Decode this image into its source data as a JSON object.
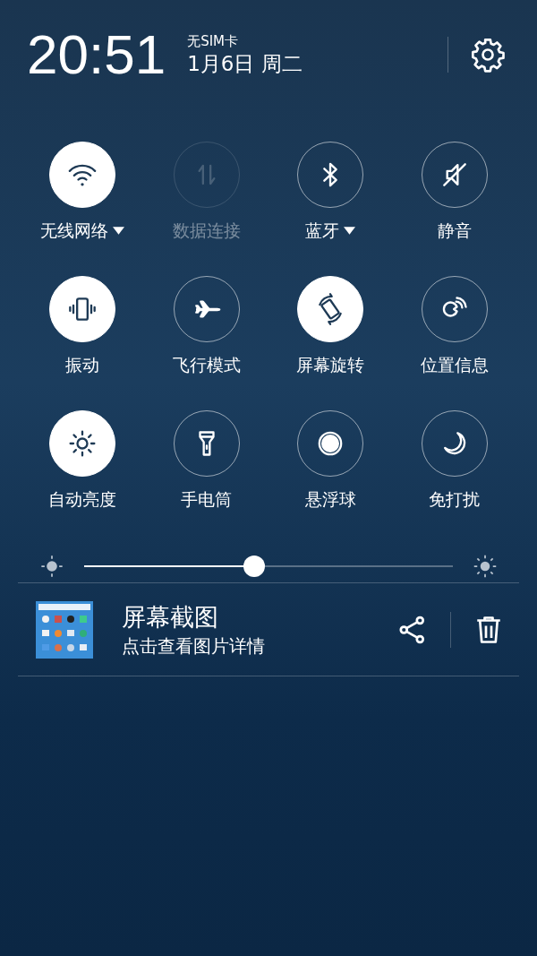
{
  "header": {
    "time": "20:51",
    "sim": "无SIM卡",
    "date": "1月6日 周二"
  },
  "toggles": [
    {
      "kind": "wifi",
      "label": "无线网络",
      "on": true,
      "disabled": false,
      "has_menu": true
    },
    {
      "kind": "data",
      "label": "数据连接",
      "on": false,
      "disabled": true,
      "has_menu": false
    },
    {
      "kind": "bluetooth",
      "label": "蓝牙",
      "on": false,
      "disabled": false,
      "has_menu": true
    },
    {
      "kind": "mute",
      "label": "静音",
      "on": false,
      "disabled": false,
      "has_menu": false
    },
    {
      "kind": "vibrate",
      "label": "振动",
      "on": true,
      "disabled": false,
      "has_menu": false
    },
    {
      "kind": "airplane",
      "label": "飞行模式",
      "on": false,
      "disabled": false,
      "has_menu": false
    },
    {
      "kind": "rotate",
      "label": "屏幕旋转",
      "on": true,
      "disabled": false,
      "has_menu": false
    },
    {
      "kind": "location",
      "label": "位置信息",
      "on": false,
      "disabled": false,
      "has_menu": false
    },
    {
      "kind": "brightness",
      "label": "自动亮度",
      "on": true,
      "disabled": false,
      "has_menu": false
    },
    {
      "kind": "flashlight",
      "label": "手电筒",
      "on": false,
      "disabled": false,
      "has_menu": false
    },
    {
      "kind": "float",
      "label": "悬浮球",
      "on": false,
      "disabled": false,
      "has_menu": false
    },
    {
      "kind": "moon",
      "label": "免打扰",
      "on": false,
      "disabled": false,
      "has_menu": false
    }
  ],
  "brightness": {
    "level": 0.46
  },
  "notification": {
    "title": "屏幕截图",
    "text": "点击查看图片详情"
  }
}
